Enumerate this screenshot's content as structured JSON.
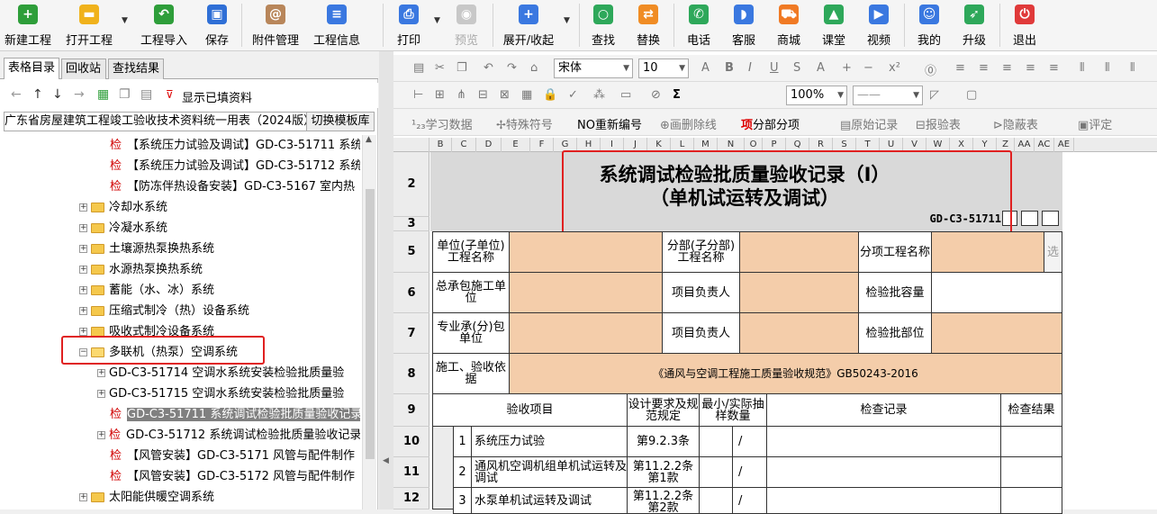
{
  "toolbar": {
    "new_project": "新建工程",
    "open_project": "打开工程",
    "import_project": "工程导入",
    "save": "保存",
    "attachment_manage": "附件管理",
    "project_info": "工程信息",
    "print": "打印",
    "preview": "预览",
    "expand_collapse": "展开/收起",
    "find": "查找",
    "replace": "替换",
    "phone": "电话",
    "support": "客服",
    "mall": "商城",
    "classroom": "课堂",
    "video": "视频",
    "mine": "我的",
    "upgrade": "升级",
    "exit": "退出"
  },
  "left_panel": {
    "tabs": [
      "表格目录",
      "回收站",
      "查找结果"
    ],
    "show_filled": "显示已填资料",
    "template_name": "广东省房屋建筑工程竣工验收技术资料统一用表（2024版）",
    "switch_template": "切换模板库",
    "tree": [
      {
        "mark": "检",
        "label": "【系统压力试验及调试】GD-C3-51711 系统"
      },
      {
        "mark": "检",
        "label": "【系统压力试验及调试】GD-C3-51712 系统"
      },
      {
        "mark": "检",
        "label": "【防冻伴热设备安装】GD-C3-5167 室内热"
      },
      {
        "label": "冷却水系统"
      },
      {
        "label": "冷凝水系统"
      },
      {
        "label": "土壤源热泵换热系统"
      },
      {
        "label": "水源热泵换热系统"
      },
      {
        "label": "蓄能（水、冰）系统"
      },
      {
        "label": "压缩式制冷（热）设备系统"
      },
      {
        "label": "吸收式制冷设备系统"
      },
      {
        "label": "多联机（热泵）空调系统"
      },
      {
        "label": "GD-C3-51714 空调水系统安装检验批质量验"
      },
      {
        "label": "GD-C3-51715 空调水系统安装检验批质量验"
      },
      {
        "mark": "检",
        "label": "GD-C3-51711 系统调试检验批质量验收记录"
      },
      {
        "mark": "检",
        "label": "GD-C3-51712 系统调试检验批质量验收记录"
      },
      {
        "mark": "检",
        "label": "【风管安装】GD-C3-5171 风管与配件制作"
      },
      {
        "mark": "检",
        "label": "【风管安装】GD-C3-5172 风管与配件制作"
      },
      {
        "label": "太阳能供暖空调系统"
      }
    ]
  },
  "editor": {
    "font_name": "宋体",
    "font_size": "10",
    "zoom": "100%",
    "tools": {
      "study_data": "学习数据",
      "special_symbol": "特殊符号",
      "renumber": "重新编号",
      "strike_line": "画删除线",
      "sub_item": "分部分项",
      "original_record": "原始记录",
      "report_table": "报验表",
      "hidden_table": "隐蔽表",
      "evaluate": "评定"
    },
    "column_headers": [
      "B",
      "C",
      "D",
      "E",
      "F",
      "G",
      "H",
      "I",
      "J",
      "K",
      "L",
      "M",
      "N",
      "O",
      "P",
      "Q",
      "R",
      "S",
      "T",
      "U",
      "V",
      "W",
      "X",
      "Y",
      "Z",
      "AA",
      "AC",
      "AE"
    ],
    "row_headers": [
      "2",
      "3",
      "5",
      "6",
      "7",
      "8",
      "9",
      "10",
      "11",
      "12"
    ]
  },
  "form": {
    "title_line1": "系统调试检验批质量验收记录（Ⅰ）",
    "title_line2": "（单机试运转及调试）",
    "code": "GD-C3-51711",
    "unit_label": "单位(子单位)工程名称",
    "division_label": "分部(子分部)工程名称",
    "subitem_label": "分项工程名称",
    "select_label": "选",
    "contractor_label": "总承包施工单位",
    "pm_label": "项目负责人",
    "capacity_label": "检验批容量",
    "subcontractor_label": "专业承(分)包单位",
    "pm_label2": "项目负责人",
    "location_label": "检验批部位",
    "basis_label": "施工、验收依据",
    "basis_value": "《通风与空调工程施工质量验收规范》GB50243-2016",
    "col_items": "验收项目",
    "col_design": "设计要求及规范规定",
    "col_sample": "最小/实际抽样数量",
    "col_record": "检查记录",
    "col_result": "检查结果",
    "rows": [
      {
        "no": "1",
        "item": "系统压力试验",
        "clause": "第9.2.3条",
        "sample": "/"
      },
      {
        "no": "2",
        "item": "通风机空调机组单机试运转及调试",
        "clause": "第11.2.2条第1款",
        "sample": "/"
      },
      {
        "no": "3",
        "item": "水泵单机试运转及调试",
        "clause": "第11.2.2条第2款",
        "sample": "/"
      }
    ]
  }
}
